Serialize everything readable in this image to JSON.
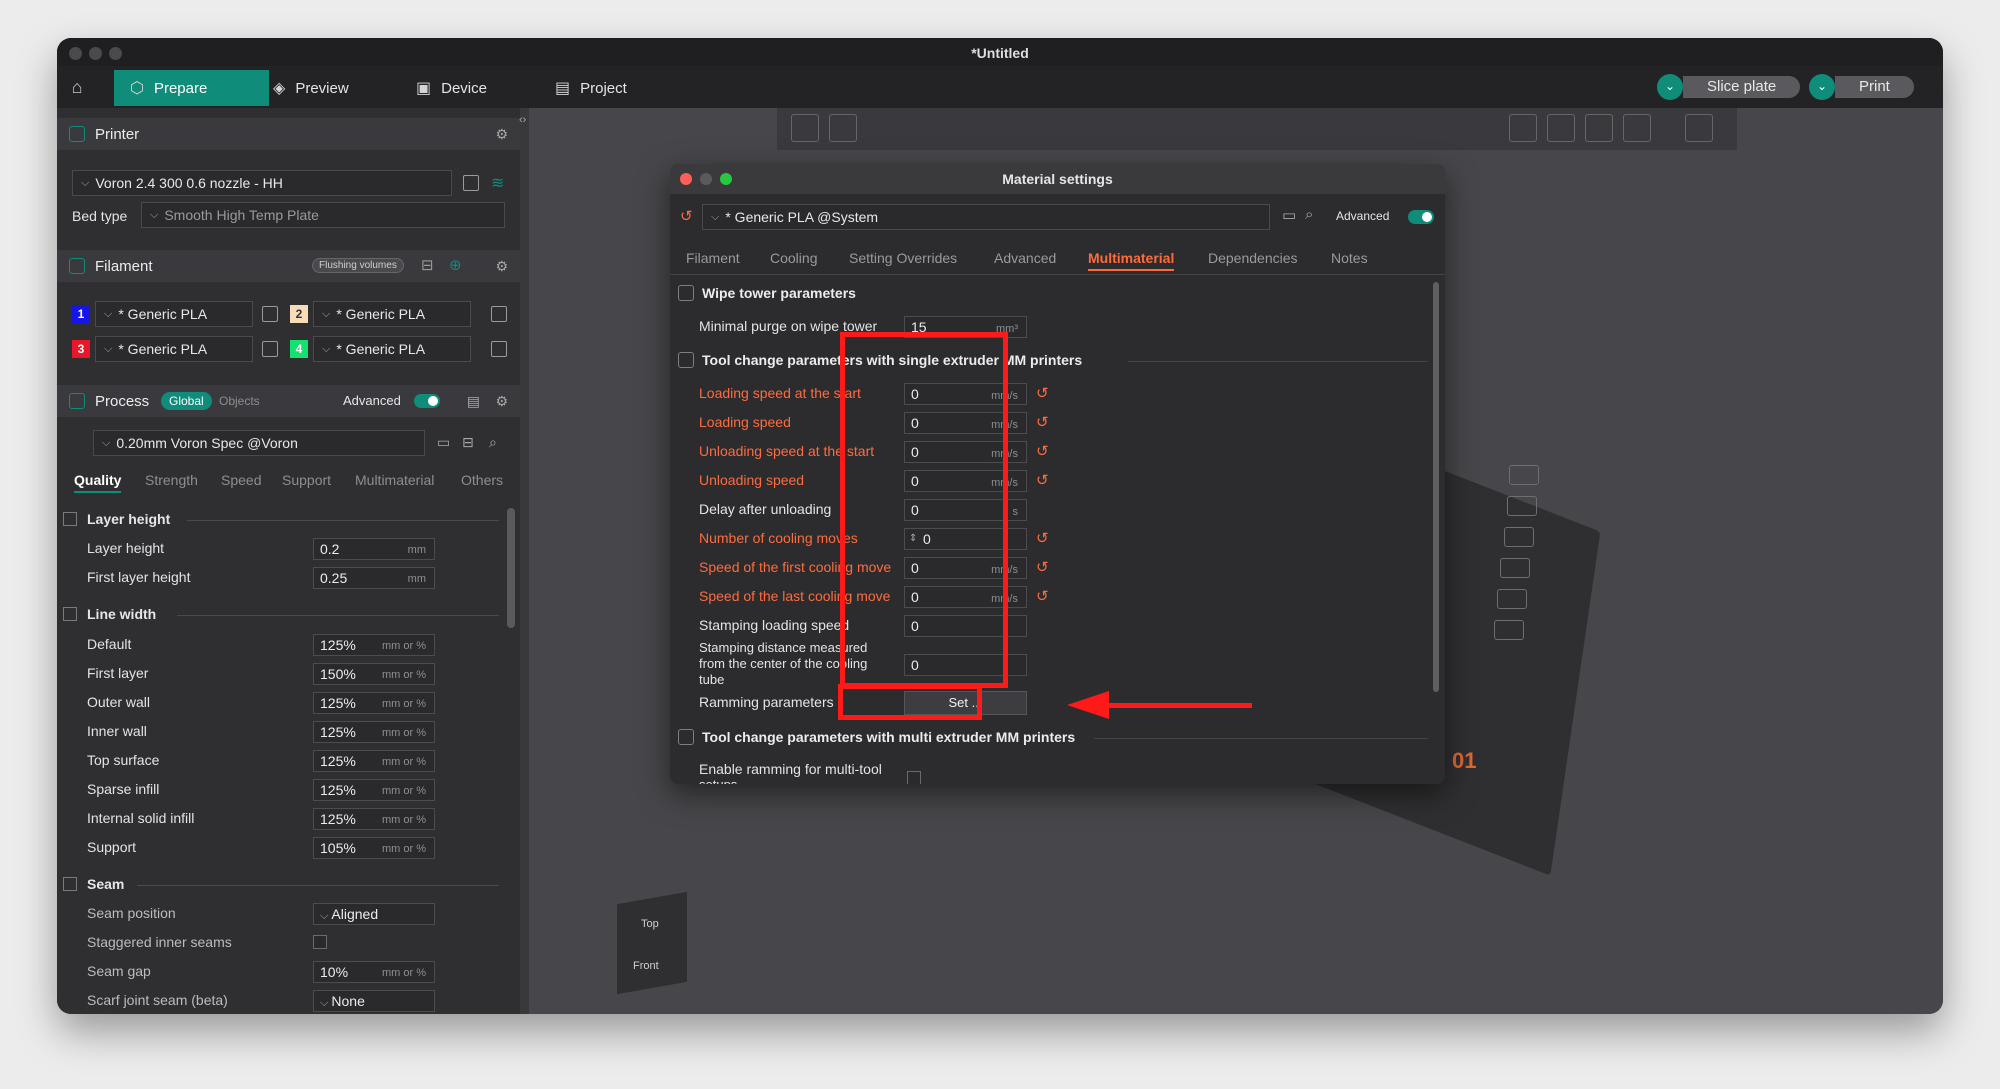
{
  "window": {
    "title": "*Untitled"
  },
  "topbar": {
    "tabs": [
      {
        "label": "Prepare",
        "icon": "cube-outline-icon"
      },
      {
        "label": "Preview",
        "icon": "layers-icon"
      },
      {
        "label": "Device",
        "icon": "device-icon"
      },
      {
        "label": "Project",
        "icon": "document-icon"
      }
    ],
    "slice_label": "Slice plate",
    "print_label": "Print"
  },
  "printer": {
    "header": "Printer",
    "preset": "Voron 2.4 300 0.6 nozzle - HH",
    "bed_type_label": "Bed type",
    "bed_type_value": "Smooth High Temp Plate"
  },
  "filament": {
    "header": "Filament",
    "flushing_label": "Flushing volumes",
    "slots": [
      {
        "num": "1",
        "color": "#1515e8",
        "name": "* Generic PLA"
      },
      {
        "num": "2",
        "color": "#f6dcb8",
        "name": "* Generic PLA"
      },
      {
        "num": "3",
        "color": "#e8182a",
        "name": "* Generic PLA"
      },
      {
        "num": "4",
        "color": "#16e070",
        "name": "* Generic PLA"
      }
    ]
  },
  "process": {
    "header": "Process",
    "global_label": "Global",
    "objects_label": "Objects",
    "advanced_label": "Advanced",
    "preset": "0.20mm Voron Spec @Voron",
    "tabs": [
      "Quality",
      "Strength",
      "Speed",
      "Support",
      "Multimaterial",
      "Others"
    ],
    "layer_height_group": "Layer height",
    "layer_height_rows": [
      {
        "label": "Layer height",
        "value": "0.2",
        "unit": "mm"
      },
      {
        "label": "First layer height",
        "value": "0.25",
        "unit": "mm"
      }
    ],
    "line_width_group": "Line width",
    "line_width_rows": [
      {
        "label": "Default",
        "value": "125%",
        "unit": "mm or %"
      },
      {
        "label": "First layer",
        "value": "150%",
        "unit": "mm or %"
      },
      {
        "label": "Outer wall",
        "value": "125%",
        "unit": "mm or %"
      },
      {
        "label": "Inner wall",
        "value": "125%",
        "unit": "mm or %"
      },
      {
        "label": "Top surface",
        "value": "125%",
        "unit": "mm or %"
      },
      {
        "label": "Sparse infill",
        "value": "125%",
        "unit": "mm or %"
      },
      {
        "label": "Internal solid infill",
        "value": "125%",
        "unit": "mm or %"
      },
      {
        "label": "Support",
        "value": "105%",
        "unit": "mm or %"
      }
    ],
    "seam_group": "Seam",
    "seam_position_label": "Seam position",
    "seam_position_value": "Aligned",
    "staggered_label": "Staggered inner seams",
    "seam_gap_label": "Seam gap",
    "seam_gap_value": "10%",
    "seam_gap_unit": "mm or %",
    "scarf_label": "Scarf joint seam (beta)",
    "scarf_value": "None"
  },
  "canvas": {
    "cube_top": "Top",
    "cube_front": "Front",
    "plate_number": "01"
  },
  "dialog": {
    "title": "Material settings",
    "preset": "* Generic PLA @System",
    "advanced_label": "Advanced",
    "tabs": [
      "Filament",
      "Cooling",
      "Setting Overrides",
      "Advanced",
      "Multimaterial",
      "Dependencies",
      "Notes"
    ],
    "wipe_section": "Wipe tower parameters",
    "min_purge_label": "Minimal purge on wipe tower",
    "min_purge_value": "15",
    "min_purge_unit": "mm³",
    "single_section": "Tool change parameters with single extruder MM printers",
    "single_rows": [
      {
        "label": "Loading speed at the start",
        "value": "0",
        "unit": "mm/s",
        "modified": true
      },
      {
        "label": "Loading speed",
        "value": "0",
        "unit": "mm/s",
        "modified": true
      },
      {
        "label": "Unloading speed at the start",
        "value": "0",
        "unit": "mm/s",
        "modified": true
      },
      {
        "label": "Unloading speed",
        "value": "0",
        "unit": "mm/s",
        "modified": true
      },
      {
        "label": "Delay after unloading",
        "value": "0",
        "unit": "s",
        "modified": false
      },
      {
        "label": "Number of cooling moves",
        "value": "0",
        "unit": "",
        "modified": true
      },
      {
        "label": "Speed of the first cooling move",
        "value": "0",
        "unit": "mm/s",
        "modified": true
      },
      {
        "label": "Speed of the last cooling move",
        "value": "0",
        "unit": "mm/s",
        "modified": true
      },
      {
        "label": "Stamping loading speed",
        "value": "0",
        "unit": "",
        "modified": false
      }
    ],
    "stamping_distance_label_1": "Stamping distance measured",
    "stamping_distance_label_2": "from the center of the cooling",
    "stamping_distance_label_3": "tube",
    "stamping_distance_value": "0",
    "ramming_label": "Ramming parameters",
    "ramming_button": "Set ...",
    "multi_section": "Tool change parameters with multi extruder MM printers",
    "enable_ramming_label": "Enable ramming for multi-tool",
    "enable_ramming_label_cut": "setups"
  },
  "colors": {
    "accent": "#0f8c7a",
    "modified": "#ff6b3d",
    "annotation": "#ff1a1a"
  }
}
